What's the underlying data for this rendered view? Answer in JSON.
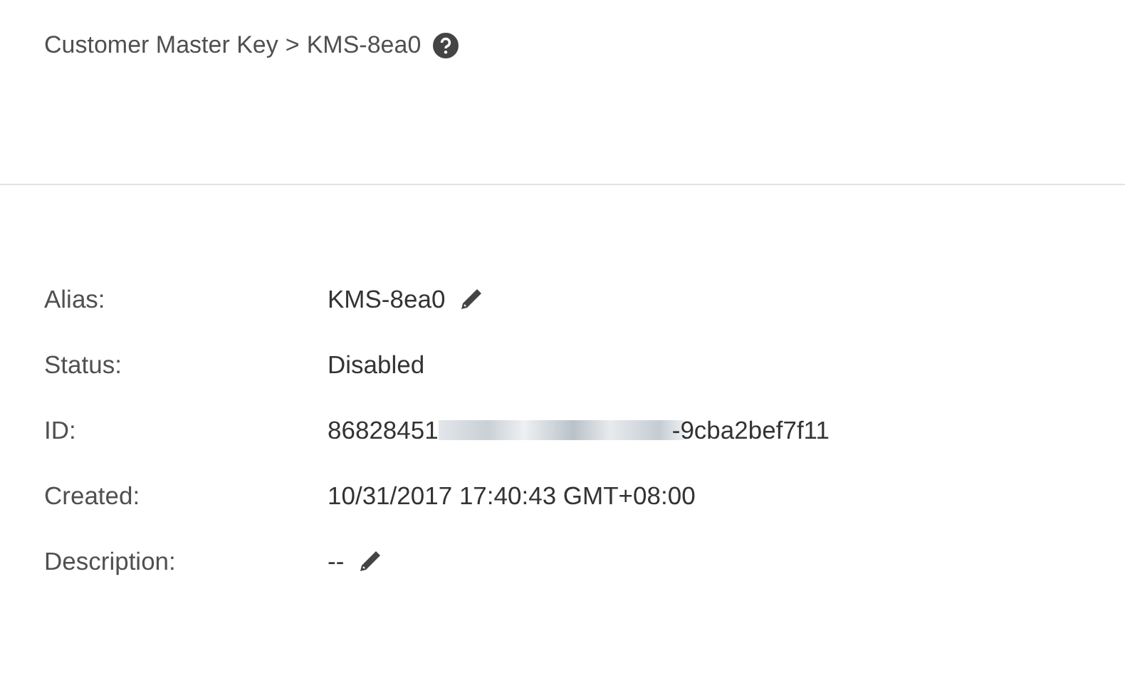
{
  "breadcrumb": {
    "parent": "Customer Master Key",
    "separator": ">",
    "current": "KMS-8ea0"
  },
  "fields": [
    {
      "label": "Alias:",
      "kind": "editable",
      "value": "KMS-8ea0"
    },
    {
      "label": "Status:",
      "kind": "text",
      "value": "Disabled"
    },
    {
      "label": "ID:",
      "kind": "redacted",
      "value_start": "86828451",
      "value_end": "-9cba2bef7f11"
    },
    {
      "label": "Created:",
      "kind": "text",
      "value": "10/31/2017 17:40:43 GMT+08:00"
    },
    {
      "label": "Description:",
      "kind": "editable",
      "value": "--"
    }
  ]
}
